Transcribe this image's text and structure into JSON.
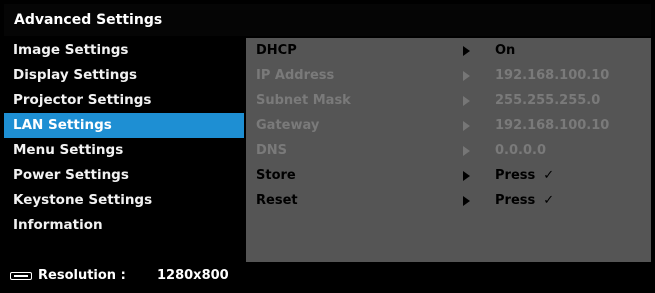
{
  "title": "Advanced Settings",
  "sidebar": {
    "items": [
      {
        "label": "Image Settings",
        "active": false
      },
      {
        "label": "Display Settings",
        "active": false
      },
      {
        "label": "Projector Settings",
        "active": false
      },
      {
        "label": "LAN Settings",
        "active": true
      },
      {
        "label": "Menu Settings",
        "active": false
      },
      {
        "label": "Power Settings",
        "active": false
      },
      {
        "label": "Keystone Settings",
        "active": false
      },
      {
        "label": "Information",
        "active": false
      }
    ]
  },
  "panel": {
    "rows": [
      {
        "label": "DHCP",
        "value": "On",
        "enabled": true
      },
      {
        "label": "IP Address",
        "value": "192.168.100.10",
        "enabled": false
      },
      {
        "label": "Subnet Mask",
        "value": "255.255.255.0",
        "enabled": false
      },
      {
        "label": "Gateway",
        "value": "192.168.100.10",
        "enabled": false
      },
      {
        "label": "DNS",
        "value": "0.0.0.0",
        "enabled": false
      },
      {
        "label": "Store",
        "value": "Press",
        "check": "✓",
        "enabled": true
      },
      {
        "label": "Reset",
        "value": "Press",
        "check": "✓",
        "enabled": true
      }
    ]
  },
  "status": {
    "icon": "monitor-icon",
    "resolution_label": "Resolution :",
    "resolution_value": "1280x800"
  },
  "colors": {
    "accent": "#1e8fd3",
    "panel_bg": "#555555",
    "disabled_text": "#7a7a7a"
  }
}
